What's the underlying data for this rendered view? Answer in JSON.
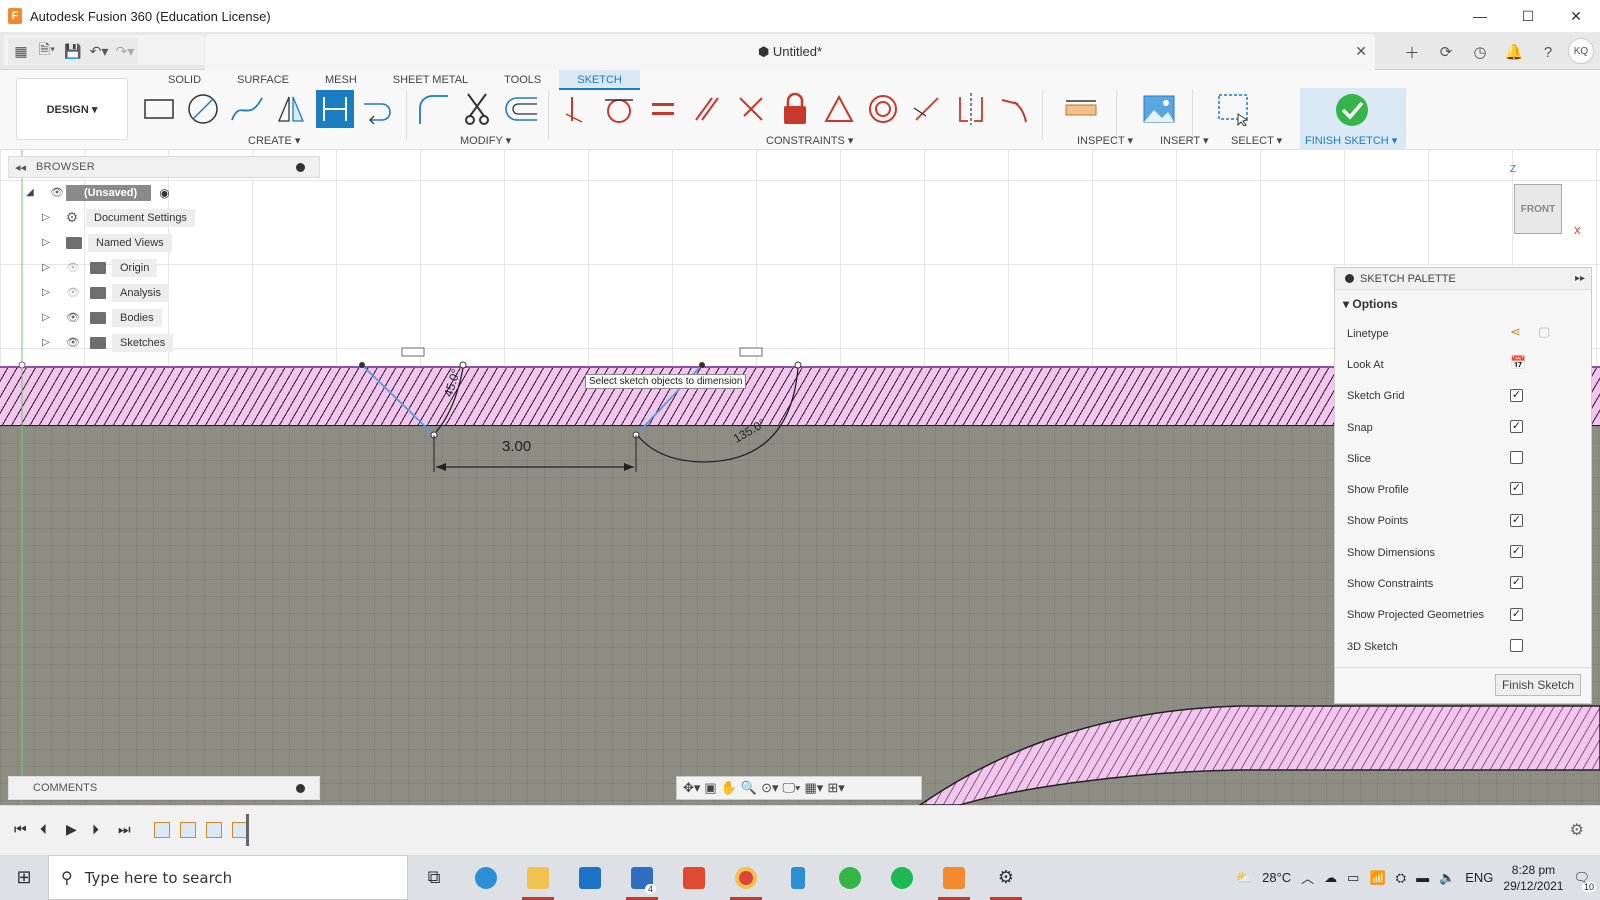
{
  "window": {
    "title": "Autodesk Fusion 360 (Education License)",
    "minimize": "—",
    "maximize": "☐",
    "close": "✕"
  },
  "doc_tab": {
    "title": "Untitled*",
    "close": "✕"
  },
  "user": {
    "initials": "KQ"
  },
  "workspace": {
    "label": "DESIGN ▾"
  },
  "ws_tabs": [
    "SOLID",
    "SURFACE",
    "MESH",
    "SHEET METAL",
    "TOOLS",
    "SKETCH"
  ],
  "ws_active": "SKETCH",
  "groups": {
    "create": "CREATE ▾",
    "modify": "MODIFY ▾",
    "constraints": "CONSTRAINTS ▾",
    "inspect": "INSPECT ▾",
    "insert": "INSERT ▾",
    "select": "SELECT ▾",
    "finish": "FINISH SKETCH ▾"
  },
  "browser": {
    "title": "BROWSER",
    "root": "(Unsaved)",
    "items": [
      {
        "label": "Document Settings",
        "icon": "gear-icon"
      },
      {
        "label": "Named Views",
        "icon": "folder-icon"
      },
      {
        "label": "Origin",
        "icon": "folder-icon",
        "hidden": true
      },
      {
        "label": "Analysis",
        "icon": "folder-icon",
        "hidden": true
      },
      {
        "label": "Bodies",
        "icon": "folder-icon"
      },
      {
        "label": "Sketches",
        "icon": "folder-icon"
      }
    ]
  },
  "canvas": {
    "tooltip": "Select sketch objects to dimension",
    "dim_linear": "3.00",
    "dim_angle1": "45.0°",
    "dim_angle2": "135.0°"
  },
  "viewcube": {
    "face": "FRONT",
    "z": "Z",
    "x": "X"
  },
  "palette": {
    "title": "SKETCH PALETTE",
    "section": "Options",
    "rows": [
      {
        "label": "Linetype",
        "type": "icons"
      },
      {
        "label": "Look At",
        "type": "button"
      },
      {
        "label": "Sketch Grid",
        "type": "checkbox",
        "checked": true
      },
      {
        "label": "Snap",
        "type": "checkbox",
        "checked": true
      },
      {
        "label": "Slice",
        "type": "checkbox",
        "checked": false
      },
      {
        "label": "Show Profile",
        "type": "checkbox",
        "checked": true
      },
      {
        "label": "Show Points",
        "type": "checkbox",
        "checked": true
      },
      {
        "label": "Show Dimensions",
        "type": "checkbox",
        "checked": true
      },
      {
        "label": "Show Constraints",
        "type": "checkbox",
        "checked": true
      },
      {
        "label": "Show Projected Geometries",
        "type": "checkbox",
        "checked": true
      },
      {
        "label": "3D Sketch",
        "type": "checkbox",
        "checked": false
      }
    ],
    "finish_button": "Finish Sketch"
  },
  "comments": {
    "title": "COMMENTS"
  },
  "taskbar": {
    "search_placeholder": "Type here to search",
    "temperature": "28°C",
    "language": "ENG",
    "time": "8:28 pm",
    "date": "29/12/2021",
    "mail_badge": "4",
    "notification_badge": "10"
  },
  "colors": {
    "accent": "#1a7cc1",
    "profile_fill": "#f3c4ee",
    "canvas_gray": "#8e8d84"
  }
}
